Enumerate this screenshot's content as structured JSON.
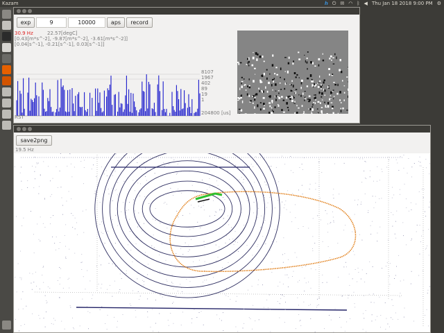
{
  "topbar": {
    "app_title": "Kazam",
    "datetime": "Thu Jan 18 2018  9:00 PM"
  },
  "launcher": {
    "icons": [
      {
        "name": "dash-icon",
        "color": "#8a8883"
      },
      {
        "name": "files-icon",
        "color": "#c4c2bd"
      },
      {
        "name": "terminal-icon",
        "color": "#2b2b2b"
      },
      {
        "name": "text-editor-icon",
        "color": "#d6d4d0"
      },
      {
        "name": "settings-icon",
        "color": "#6b6a66"
      },
      {
        "name": "firefox-icon",
        "color": "#e66000"
      },
      {
        "name": "firefox-icon-2",
        "color": "#d35400"
      },
      {
        "name": "app-icon-a",
        "color": "#bdbbb6"
      },
      {
        "name": "app-icon-b",
        "color": "#bdbbb6"
      },
      {
        "name": "app-icon-c",
        "color": "#bdbbb6"
      },
      {
        "name": "app-icon-d",
        "color": "#bdbbb6"
      }
    ],
    "trash_icon": "trash-icon"
  },
  "control": {
    "exp_label": "exp",
    "exp_value": "9",
    "exposure_value": "10000",
    "aps_label": "aps",
    "record_label": "record",
    "rate": "30.9 Hz",
    "temperature": "22.57[degC]",
    "accel": "[0.43[m*s^-2], -9.87[m*s^-2], -3.61[m*s^-2]]",
    "gyro": "[0.04[s^-1], -0.21[s^-1], 0.03[s^-1]]",
    "rst_label": "RST",
    "axis_labels": [
      "8107",
      "1967",
      "402",
      "89",
      "19",
      "1",
      "204800 [us]"
    ],
    "hist_color": "#1a1acc"
  },
  "viewer": {
    "save_label": "save2png",
    "rate": "19.5 Hz",
    "trajectory_color": "#e07a10",
    "circle_color": "#2b2b5e",
    "highlight_color": "#2fc02f"
  }
}
